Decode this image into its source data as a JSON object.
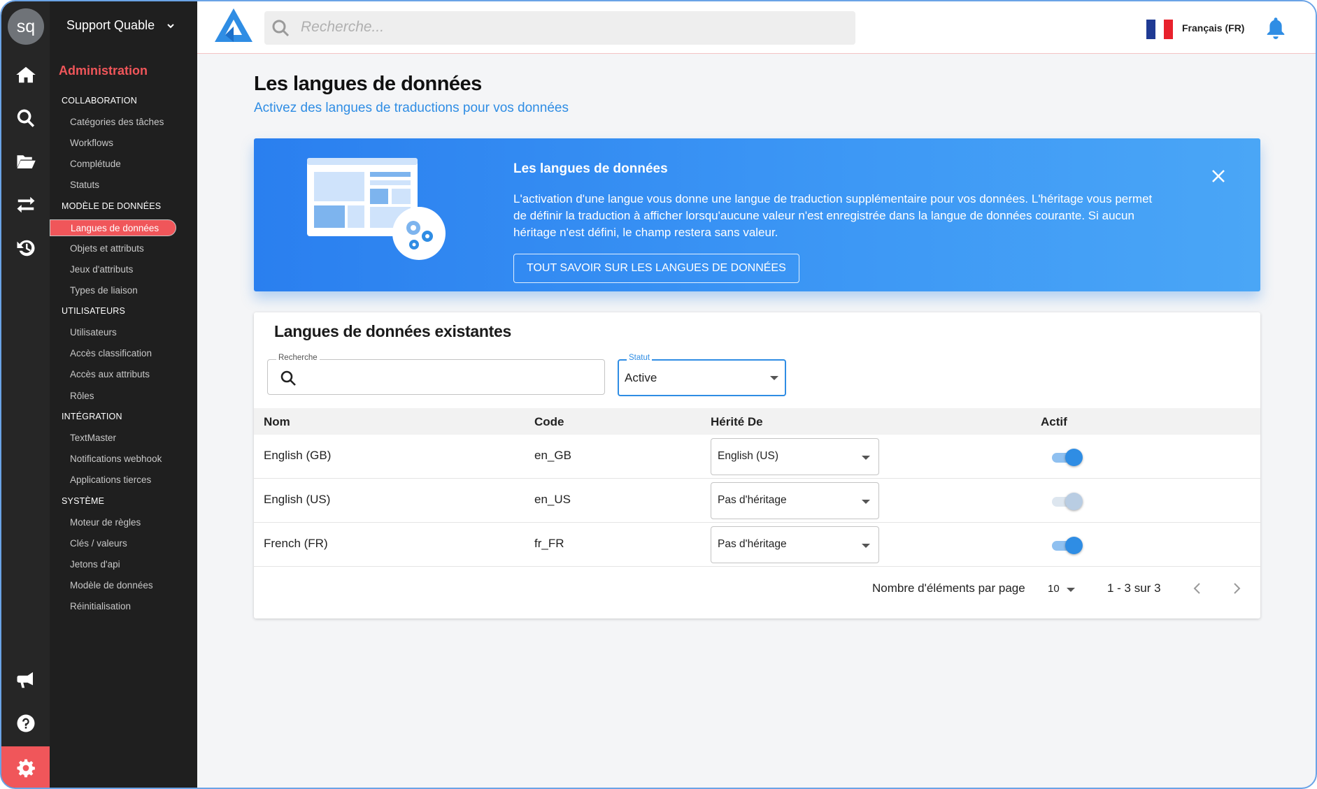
{
  "sidebar": {
    "avatar": "sq",
    "org_name": "Support Quable",
    "section_title": "Administration",
    "rail_icons": [
      "home-icon",
      "search-icon",
      "folder-open-icon",
      "exchange-icon",
      "history-icon",
      "megaphone-icon",
      "help-icon",
      "gear-icon"
    ],
    "groups": [
      {
        "label": "COLLABORATION",
        "items": [
          "Catégories des tâches",
          "Workflows",
          "Complétude",
          "Statuts"
        ]
      },
      {
        "label": "MODÈLE DE DONNÉES",
        "items": [
          "Langues de données",
          "Objets et attributs",
          "Jeux d'attributs",
          "Types de liaison"
        ]
      },
      {
        "label": "UTILISATEURS",
        "items": [
          "Utilisateurs",
          "Accès classification",
          "Accès aux attributs",
          "Rôles"
        ]
      },
      {
        "label": "INTÉGRATION",
        "items": [
          "TextMaster",
          "Notifications webhook",
          "Applications tierces"
        ]
      },
      {
        "label": "SYSTÈME",
        "items": [
          "Moteur de règles",
          "Clés / valeurs",
          "Jetons d'api",
          "Modèle de données",
          "Réinitialisation"
        ]
      }
    ],
    "selected_item": "Langues de données"
  },
  "topbar": {
    "search_placeholder": "Recherche...",
    "language": "Français (FR)",
    "colors": {
      "flag_blue": "#1f3a93",
      "flag_white": "#ffffff",
      "flag_red": "#e8212c",
      "bell": "#2f8de4"
    }
  },
  "page": {
    "title": "Les langues de données",
    "subtitle": "Activez des langues de traductions pour vos données"
  },
  "banner": {
    "title": "Les langues de données",
    "text": "L'activation d'une langue vous donne une langue de traduction supplémentaire pour vos données. L'héritage vous permet de définir la traduction à afficher lorsqu'aucune valeur n'est enregistrée dans la langue de données courante. Si aucun héritage n'est défini, le champ restera sans valeur.",
    "button": "TOUT SAVOIR SUR LES LANGUES DE DONNÉES"
  },
  "table_card": {
    "title": "Langues de données existantes",
    "search_label": "Recherche",
    "search_value": "",
    "status_label": "Statut",
    "status_value": "Active",
    "columns": [
      "Nom",
      "Code",
      "Hérité De",
      "Actif"
    ],
    "rows": [
      {
        "name": "English (GB)",
        "code": "en_GB",
        "inherited": "English (US)",
        "active": true
      },
      {
        "name": "English (US)",
        "code": "en_US",
        "inherited": "Pas d'héritage",
        "active": true,
        "disabled": true
      },
      {
        "name": "French (FR)",
        "code": "fr_FR",
        "inherited": "Pas d'héritage",
        "active": true
      }
    ],
    "pagination": {
      "per_page_label": "Nombre d'éléments par page",
      "per_page_value": "10",
      "range": "1 - 3 sur 3"
    }
  },
  "colors": {
    "accent": "#f0565a",
    "primary": "#2f8de4",
    "sidebar_bg": "#1f1f1f",
    "rail_bg": "#262626"
  }
}
